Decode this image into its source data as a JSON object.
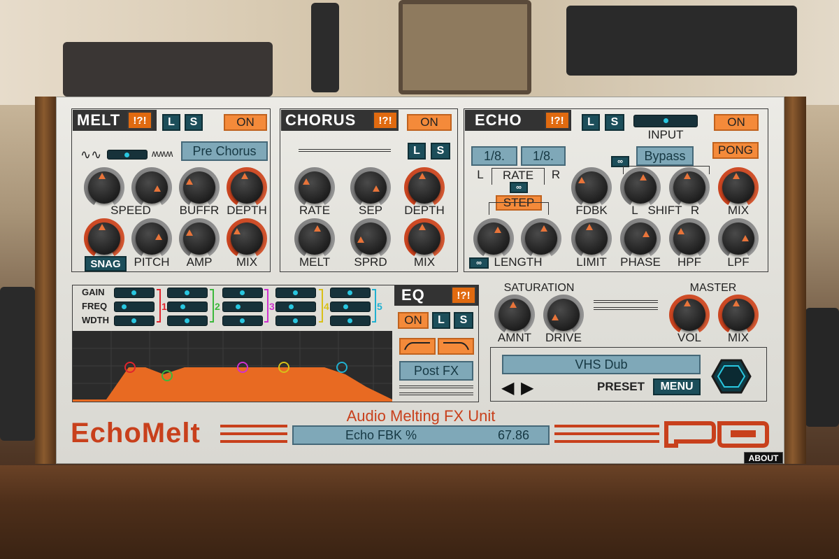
{
  "melt": {
    "title": "MELT",
    "warn": "!?!",
    "l": "L",
    "s": "S",
    "on": "ON",
    "mode": "Pre Chorus",
    "snag": "SNAG",
    "knobs": [
      "SPEED",
      "BUFFR",
      "DEPTH",
      "PITCH",
      "AMP",
      "MIX"
    ]
  },
  "chorus": {
    "title": "CHORUS",
    "warn": "!?!",
    "on": "ON",
    "l": "L",
    "s": "S",
    "knobs": [
      "RATE",
      "SEP",
      "DEPTH",
      "MELT",
      "SPRD",
      "MIX"
    ]
  },
  "echo": {
    "title": "ECHO",
    "warn": "!?!",
    "l": "L",
    "s": "S",
    "on": "ON",
    "input": "INPUT",
    "pong": "PONG",
    "bypass": "Bypass",
    "rate_l": "1/8.",
    "rate_r": "1/8.",
    "rate_label": "RATE",
    "left": "L",
    "right": "R",
    "step": "STEP",
    "length": "LENGTH",
    "knobs": [
      "FDBK",
      "L",
      "SHIFT",
      "R",
      "MIX",
      "LIMIT",
      "PHASE",
      "HPF",
      "LPF"
    ]
  },
  "eq": {
    "title": "EQ",
    "warn": "!?!",
    "on": "ON",
    "l": "L",
    "s": "S",
    "post": "Post FX",
    "rows": [
      "GAIN",
      "FREQ",
      "WDTH"
    ],
    "bands": [
      "1",
      "2",
      "3",
      "4",
      "5"
    ],
    "band_colors": [
      "#e0242c",
      "#3cb83c",
      "#d030d0",
      "#d8c018",
      "#20b0d0"
    ]
  },
  "saturation": {
    "title": "SATURATION",
    "amnt": "AMNT",
    "drive": "DRIVE"
  },
  "master": {
    "title": "MASTER",
    "vol": "VOL",
    "mix": "MIX"
  },
  "preset": {
    "name": "VHS Dub",
    "label": "PRESET",
    "menu": "MENU"
  },
  "footer": {
    "logo": "EchoMelt",
    "subtitle": "Audio Melting FX Unit",
    "param_name": "Echo FBK %",
    "param_value": "67.86",
    "about": "ABOUT"
  },
  "colors": {
    "accent": "#f48a3a",
    "teal": "#1c4e5a",
    "lcd": "#7fa8b8"
  }
}
